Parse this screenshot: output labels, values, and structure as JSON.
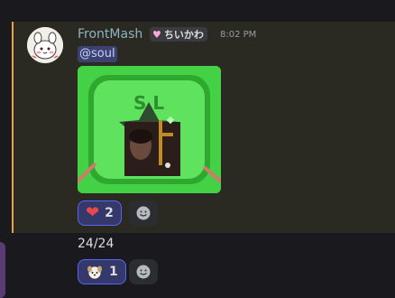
{
  "message1": {
    "username": "FrontMash",
    "role_tag": "ちいかわ",
    "timestamp": "8:02 PM",
    "mention": "@soul",
    "reactions": [
      {
        "emoji_name": "red-heart-icon",
        "count": "2"
      }
    ]
  },
  "message2": {
    "text": "24/24",
    "reactions": [
      {
        "emoji_name": "dog-face-icon",
        "count": "1"
      }
    ]
  },
  "image": {
    "overlay_text": "S L"
  },
  "colors": {
    "username": "#8ab3c5",
    "highlight_border": "#e6a23c",
    "mention_bg": "#3c4270",
    "reaction_active_border": "#5865f2",
    "image_bg": "#4ad54a"
  }
}
